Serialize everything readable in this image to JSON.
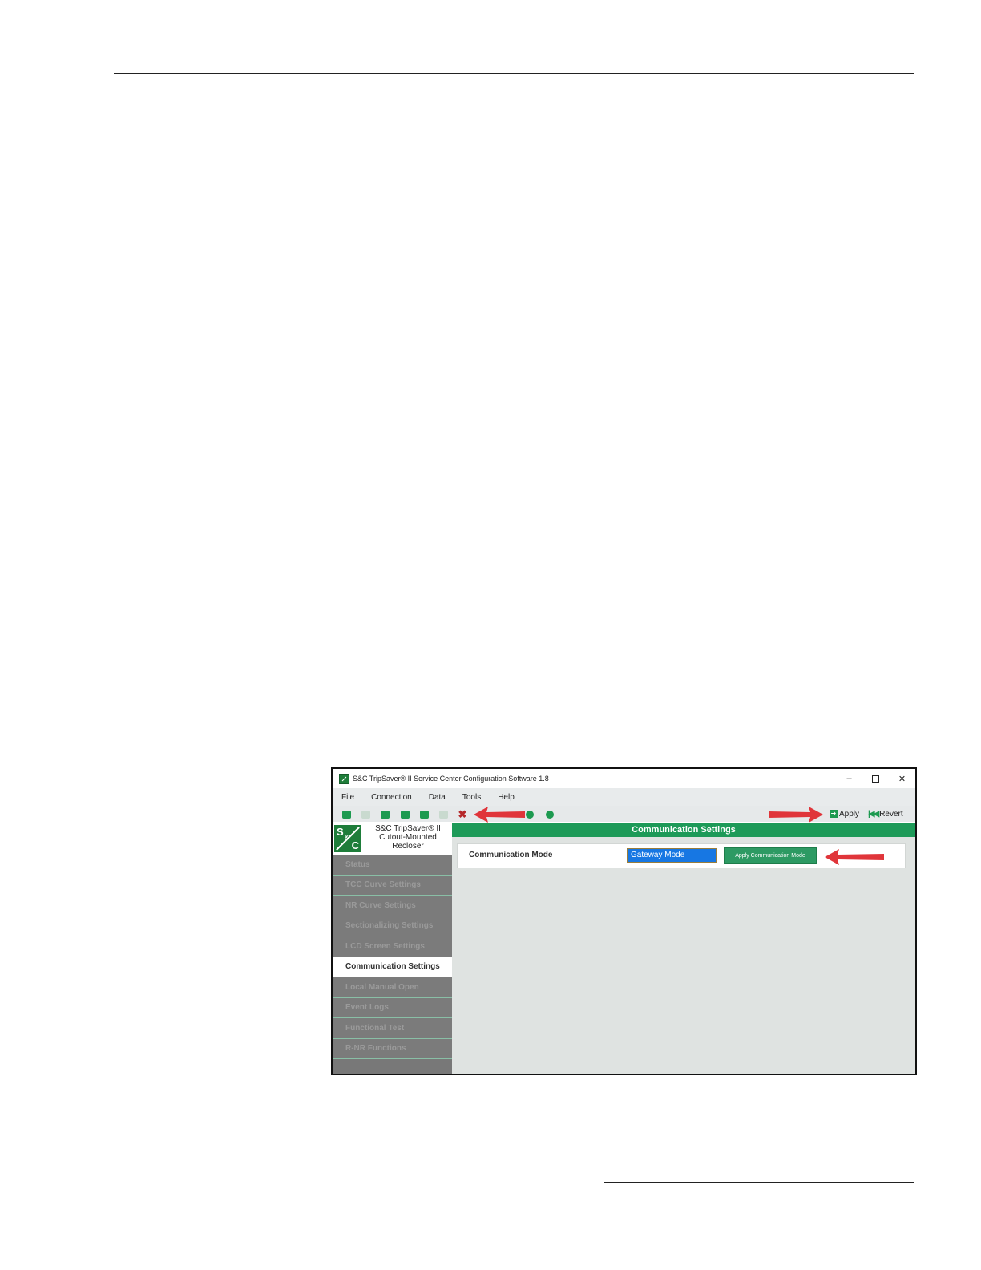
{
  "window": {
    "title": "S&C TripSaver® II Service Center Configuration Software 1.8",
    "controls": {
      "minimize": "–",
      "close": "✕"
    }
  },
  "menu": [
    "File",
    "Connection",
    "Data",
    "Tools",
    "Help"
  ],
  "toolbar": {
    "icons": [
      "connect-icon",
      "disconnect-icon",
      "snapshot-icon",
      "read-icon",
      "print-icon",
      "wireless-icon",
      "disconnect-x-icon",
      "export-icon",
      "zoom-in-icon",
      "zoom-out-icon"
    ],
    "apply_label": "Apply",
    "revert_label": "Revert"
  },
  "product": {
    "logo_text": {
      "s": "S",
      "amp": "&",
      "c": "C"
    },
    "line1": "S&C TripSaver® II",
    "line2": "Cutout-Mounted",
    "line3": "Recloser"
  },
  "nav": {
    "items": [
      "Status",
      "TCC Curve Settings",
      "NR Curve Settings",
      "Sectionalizing Settings",
      "LCD Screen Settings",
      "Communication Settings",
      "Local Manual Open",
      "Event Logs",
      "Functional Test",
      "R-NR Functions"
    ],
    "active": "Communication Settings"
  },
  "main": {
    "header": "Communication Settings",
    "mode_label": "Communication Mode",
    "mode_value": "Gateway Mode",
    "apply_mode_button": "Apply Communication Mode"
  },
  "colors": {
    "accent_green": "#1d9a58",
    "selection_blue": "#1777e3",
    "annotation_red": "#e0353a"
  }
}
